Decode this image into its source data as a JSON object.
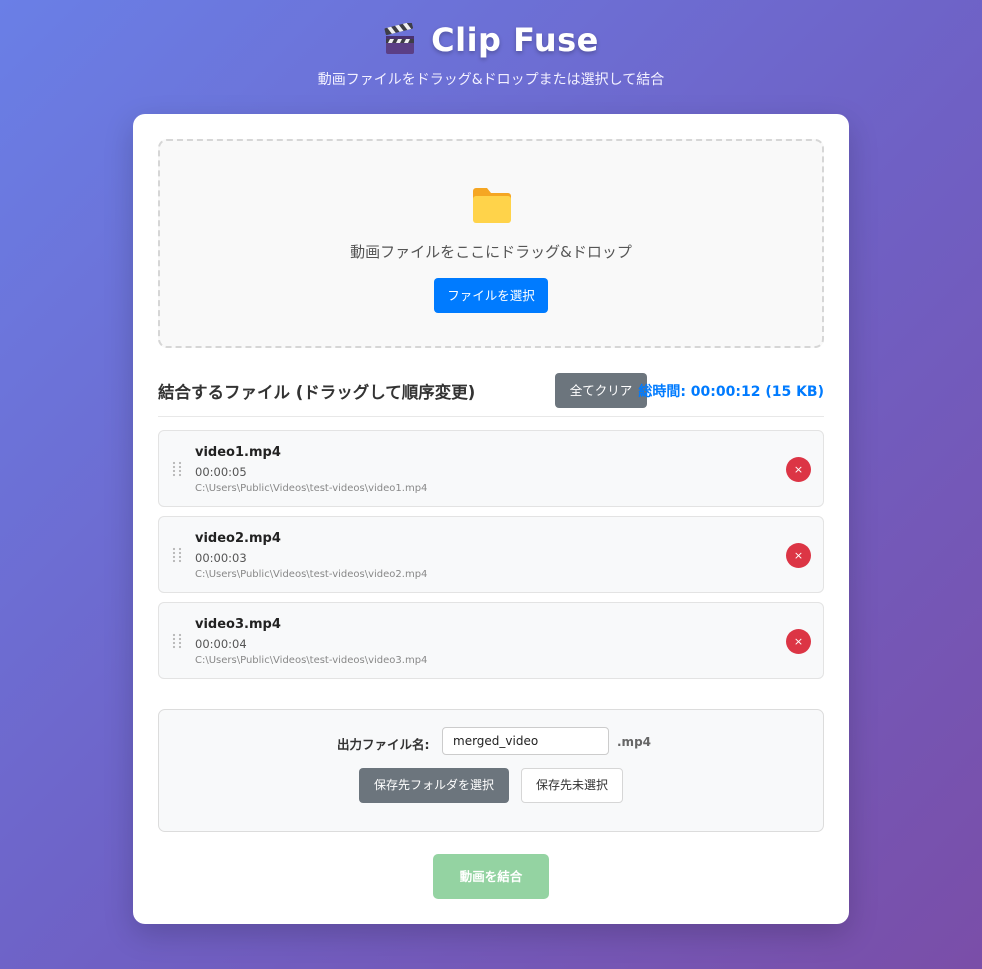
{
  "app": {
    "title": "Clip Fuse",
    "subtitle": "動画ファイルをドラッグ&ドロップまたは選択して結合",
    "icon": "clapperboard-icon"
  },
  "drop_zone": {
    "icon": "folder-icon",
    "text": "動画ファイルをここにドラッグ&ドロップ",
    "select_button": "ファイルを選択"
  },
  "file_list": {
    "title": "結合するファイル (ドラッグして順序変更)",
    "clear_button": "全てクリア",
    "total": "総時間: 00:00:12 (15 KB)",
    "files": [
      {
        "name": "video1.mp4",
        "duration": "00:00:05",
        "path": "C:\\Users\\Public\\Videos\\test-videos\\video1.mp4",
        "remove_label": "×"
      },
      {
        "name": "video2.mp4",
        "duration": "00:00:03",
        "path": "C:\\Users\\Public\\Videos\\test-videos\\video2.mp4",
        "remove_label": "×"
      },
      {
        "name": "video3.mp4",
        "duration": "00:00:04",
        "path": "C:\\Users\\Public\\Videos\\test-videos\\video3.mp4",
        "remove_label": "×"
      }
    ]
  },
  "output": {
    "label": "出力ファイル名:",
    "filename_value": "merged_video",
    "extension": ".mp4",
    "select_folder_button": "保存先フォルダを選択",
    "folder_status": "保存先未選択"
  },
  "merge_button": "動画を結合",
  "colors": {
    "primary": "#007bff",
    "secondary": "#6c757d",
    "danger": "#dc3545",
    "success_disabled": "#94d3a2",
    "background_start": "#6a7fe6",
    "background_end": "#7a4ea8"
  }
}
